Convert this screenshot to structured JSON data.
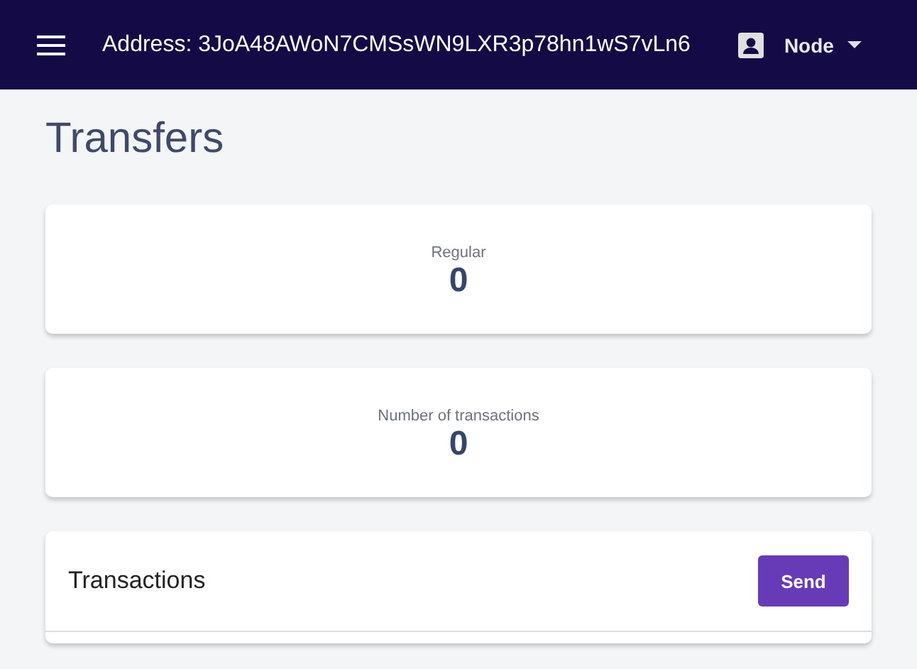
{
  "header": {
    "address": "Address: 3JoA48AWoN7CMSsWN9LXR3p78hn1wS7vLn6",
    "node_label": "Node"
  },
  "page_title": "Transfers",
  "stats": [
    {
      "label": "Regular",
      "value": "0"
    },
    {
      "label": "Number of transactions",
      "value": "0"
    }
  ],
  "transactions": {
    "title": "Transactions",
    "button": "Send"
  }
}
